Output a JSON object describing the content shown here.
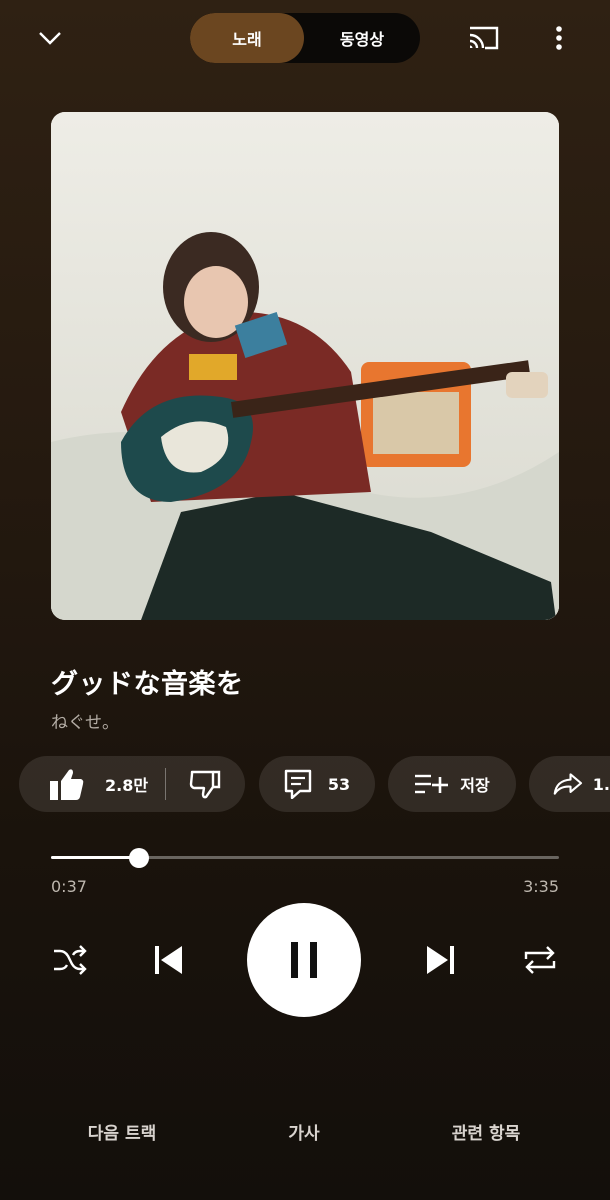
{
  "header": {
    "collapse_icon": "chevron-down-icon",
    "toggle": [
      {
        "label": "노래",
        "active": true
      },
      {
        "label": "동영상",
        "active": false
      }
    ],
    "cast_icon": "cast-icon",
    "more_icon": "more-vert-icon"
  },
  "song": {
    "title": "グッドな音楽を",
    "artist": "ねぐせ。"
  },
  "actions": {
    "like_count": "2.8만",
    "comment_count": "53",
    "save_label": "저장",
    "share_label": "1."
  },
  "progress": {
    "current": "0:37",
    "total": "3:35",
    "fraction": 0.172
  },
  "controls": {
    "shuffle_icon": "shuffle-icon",
    "prev_icon": "skip-previous-icon",
    "play_state": "playing",
    "next_icon": "skip-next-icon",
    "repeat_icon": "repeat-icon"
  },
  "tabs": [
    {
      "label": "다음 트랙"
    },
    {
      "label": "가사"
    },
    {
      "label": "관련 항목"
    }
  ],
  "colors": {
    "toggle_active": "#6b4620",
    "background_top": "#2f2113",
    "background_bottom": "#130f0b"
  }
}
